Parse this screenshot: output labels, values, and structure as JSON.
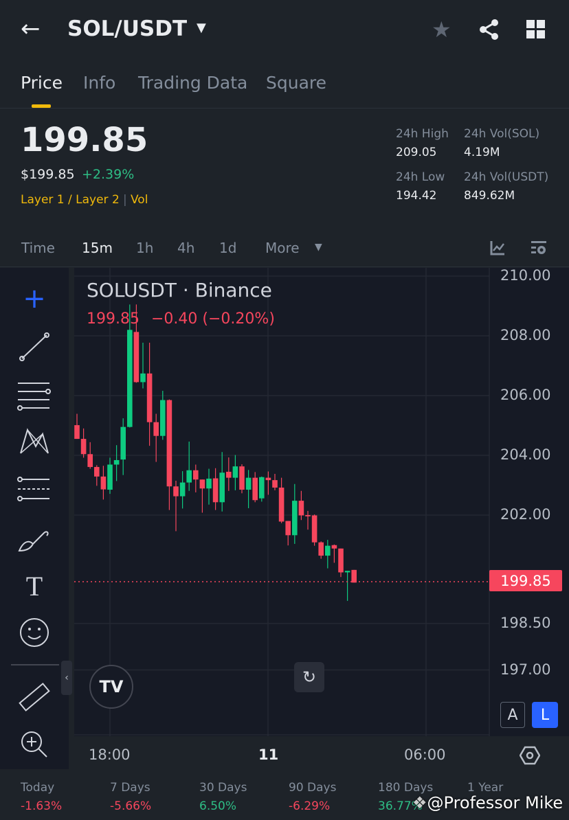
{
  "header": {
    "back": "back-arrow",
    "title": "SOL/USDT"
  },
  "tabs": [
    "Price",
    "Info",
    "Trading Data",
    "Square"
  ],
  "ticker": {
    "price": "199.85",
    "usd": "$199.85",
    "change": "+2.39%",
    "tag1": "Layer 1 / Layer 2",
    "tag2": "Vol"
  },
  "stats": {
    "high_label": "24h High",
    "high": "209.05",
    "low_label": "24h Low",
    "low": "194.42",
    "vol_sol_label": "24h Vol(SOL)",
    "vol_sol": "4.19M",
    "vol_usdt_label": "24h Vol(USDT)",
    "vol_usdt": "849.62M"
  },
  "timeframes": [
    "Time",
    "15m",
    "1h",
    "4h",
    "1d",
    "More"
  ],
  "chart_header": {
    "symbol": "SOLUSDT · Binance",
    "last": "199.85",
    "change": "−0.40 (−0.20%)"
  },
  "colors": {
    "up": "#0ecb81",
    "down": "#f6465d",
    "accent": "#f0b90b",
    "bg": "#161a25"
  },
  "chart_data": {
    "type": "candlestick",
    "ylim": [
      196.4,
      210.3
    ],
    "yticks": [
      "210.00",
      "208.00",
      "206.00",
      "204.00",
      "202.00",
      "198.50",
      "197.00"
    ],
    "ytick_values": [
      210,
      208,
      206,
      204,
      202,
      198.5,
      197
    ],
    "current_price": "199.85",
    "xticks": [
      "18:00",
      "11",
      "06:00"
    ],
    "candles": [
      [
        205.01,
        204.55,
        205.39,
        204.55
      ],
      [
        204.55,
        204.04,
        204.9,
        203.92
      ],
      [
        204.04,
        203.61,
        204.44,
        203.55
      ],
      [
        203.61,
        203.29,
        203.67,
        202.98
      ],
      [
        203.29,
        202.86,
        203.65,
        202.52
      ],
      [
        202.85,
        203.69,
        203.92,
        202.71
      ],
      [
        203.69,
        203.84,
        204.34,
        203.14
      ],
      [
        203.86,
        204.95,
        205.24,
        203.34
      ],
      [
        204.95,
        208.2,
        209.05,
        204.93
      ],
      [
        208.13,
        206.45,
        209.05,
        206.43
      ],
      [
        206.45,
        206.74,
        207.77,
        206.24
      ],
      [
        206.74,
        205.11,
        207.77,
        204.32
      ],
      [
        205.11,
        204.65,
        205.39,
        203.78
      ],
      [
        204.65,
        205.85,
        206.16,
        204.52
      ],
      [
        205.85,
        202.96,
        205.87,
        202.17
      ],
      [
        202.96,
        202.63,
        203.15,
        201.48
      ],
      [
        202.63,
        203.09,
        203.47,
        202.22
      ],
      [
        203.09,
        203.5,
        204.46,
        202.81
      ],
      [
        203.5,
        203.19,
        203.69,
        202.76
      ],
      [
        203.19,
        202.89,
        203.19,
        202.08
      ],
      [
        202.89,
        203.22,
        203.55,
        202.35
      ],
      [
        203.23,
        202.43,
        203.57,
        202.17
      ],
      [
        202.43,
        203.42,
        204.11,
        202.12
      ],
      [
        203.45,
        203.25,
        203.93,
        202.81
      ],
      [
        203.25,
        203.63,
        204.01,
        202.83
      ],
      [
        203.63,
        202.85,
        203.7,
        202.73
      ],
      [
        202.85,
        203.25,
        203.51,
        202.23
      ],
      [
        203.25,
        202.5,
        203.44,
        202.43
      ],
      [
        202.56,
        203.27,
        203.29,
        202.45
      ],
      [
        203.25,
        203.17,
        203.46,
        202.68
      ],
      [
        203.17,
        202.92,
        203.38,
        202.83
      ],
      [
        202.92,
        201.79,
        203.25,
        201.74
      ],
      [
        201.81,
        201.35,
        201.81,
        201.02
      ],
      [
        201.35,
        202.48,
        203.04,
        201.07
      ],
      [
        202.48,
        201.99,
        202.81,
        201.84
      ],
      [
        202.0,
        201.96,
        202.14,
        201.53
      ],
      [
        201.99,
        201.12,
        202.02,
        201.01
      ],
      [
        201.12,
        200.69,
        201.15,
        200.59
      ],
      [
        200.69,
        201.01,
        201.2,
        200.28
      ],
      [
        201.03,
        200.92,
        201.05,
        200.46
      ],
      [
        200.92,
        200.15,
        200.92,
        200.0
      ],
      [
        200.15,
        200.2,
        200.2,
        199.23
      ],
      [
        200.23,
        199.82,
        200.23,
        199.82
      ]
    ]
  },
  "chart_controls": {
    "auto": "A",
    "log": "L"
  },
  "performance": [
    {
      "label": "Today",
      "value": "-1.63%",
      "dir": "down"
    },
    {
      "label": "7 Days",
      "value": "-5.66%",
      "dir": "down"
    },
    {
      "label": "30 Days",
      "value": "6.50%",
      "dir": "up"
    },
    {
      "label": "90 Days",
      "value": "-6.29%",
      "dir": "down"
    },
    {
      "label": "180 Days",
      "value": "36.77%",
      "dir": "up"
    },
    {
      "label": "1 Year",
      "value": "",
      "dir": "up"
    }
  ],
  "watermark": "@Professor Mike"
}
